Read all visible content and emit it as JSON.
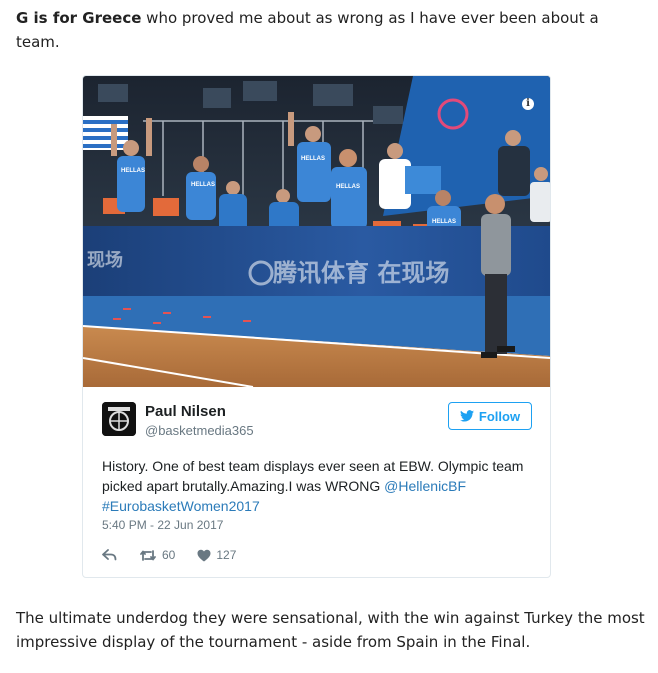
{
  "intro": {
    "lead": "G is for Greece",
    "rest": " who proved me about as wrong as I have ever been about a team."
  },
  "tweet": {
    "photo": {
      "banner_text": "腾讯体育 在现场",
      "banner_text_left": "现场",
      "jersey_text": "HELLAS",
      "info_icon": "i"
    },
    "author_name": "Paul Nilsen",
    "author_handle": "@basketmedia365",
    "follow_label": "Follow",
    "text_main": "History. One of best team displays ever seen at EBW. Olympic team picked apart brutally.Amazing.I was WRONG ",
    "mention": "@HellenicBF",
    "hashtag": "#EurobasketWomen2017",
    "time": "5:40 PM - 22 Jun 2017",
    "retweets": "60",
    "likes": "127",
    "icons": {
      "reply": "reply-icon",
      "retweet": "retweet-icon",
      "like": "heart-icon",
      "follow": "twitter-bird-icon"
    },
    "colors": {
      "link": "#2b7bb9",
      "follow": "#1da1f2",
      "court_blue": "#2f6fb6"
    }
  },
  "outro": "The ultimate underdog they were sensational, with the win against Turkey the most impressive display of the tournament - aside from Spain in the Final."
}
